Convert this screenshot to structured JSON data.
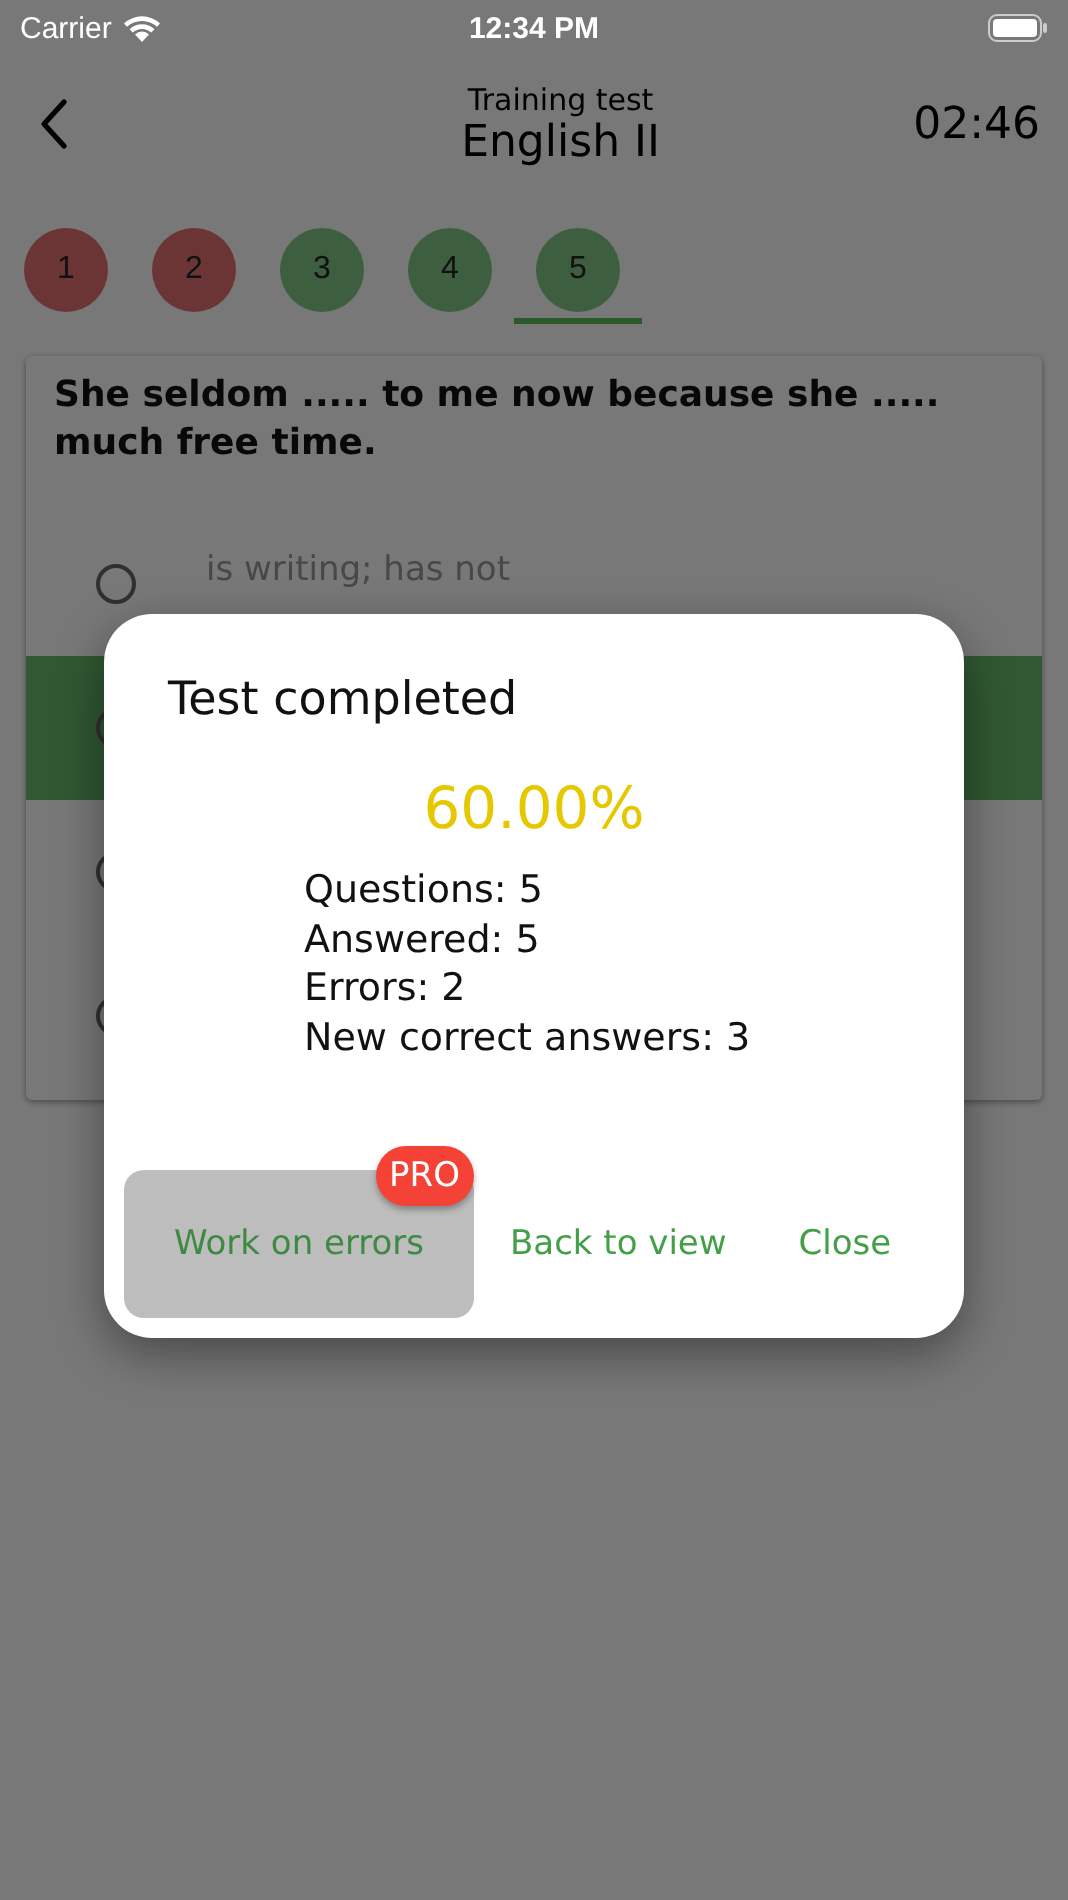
{
  "status_bar": {
    "carrier": "Carrier",
    "time": "12:34 PM"
  },
  "header": {
    "subtitle": "Training test",
    "title": "English II",
    "timer": "02:46"
  },
  "question_tabs": [
    {
      "label": "1",
      "color": "#6b3535",
      "selected": false
    },
    {
      "label": "2",
      "color": "#6b3535",
      "selected": false
    },
    {
      "label": "3",
      "color": "#3d5e3f",
      "selected": false
    },
    {
      "label": "4",
      "color": "#3d5e3f",
      "selected": false
    },
    {
      "label": "5",
      "color": "#3d5e3f",
      "selected": true
    }
  ],
  "question": {
    "text": "She seldom ..... to me now because she ..... much free time.",
    "options": [
      {
        "text": "is writing; has not",
        "checked": false,
        "correct": false
      },
      {
        "checked": false,
        "correct": true
      },
      {
        "checked": false,
        "correct": false
      },
      {
        "checked": false,
        "correct": false
      }
    ]
  },
  "dialog": {
    "title": "Test completed",
    "score": "60.00%",
    "stats": [
      "Questions: 5",
      "Answered: 5",
      "Errors: 2",
      "New correct answers: 3"
    ],
    "buttons": [
      {
        "label": "Work on errors",
        "disabled": true,
        "badge": "PRO"
      },
      {
        "label": "Back to view",
        "disabled": false
      },
      {
        "label": "Close",
        "disabled": false
      }
    ]
  }
}
